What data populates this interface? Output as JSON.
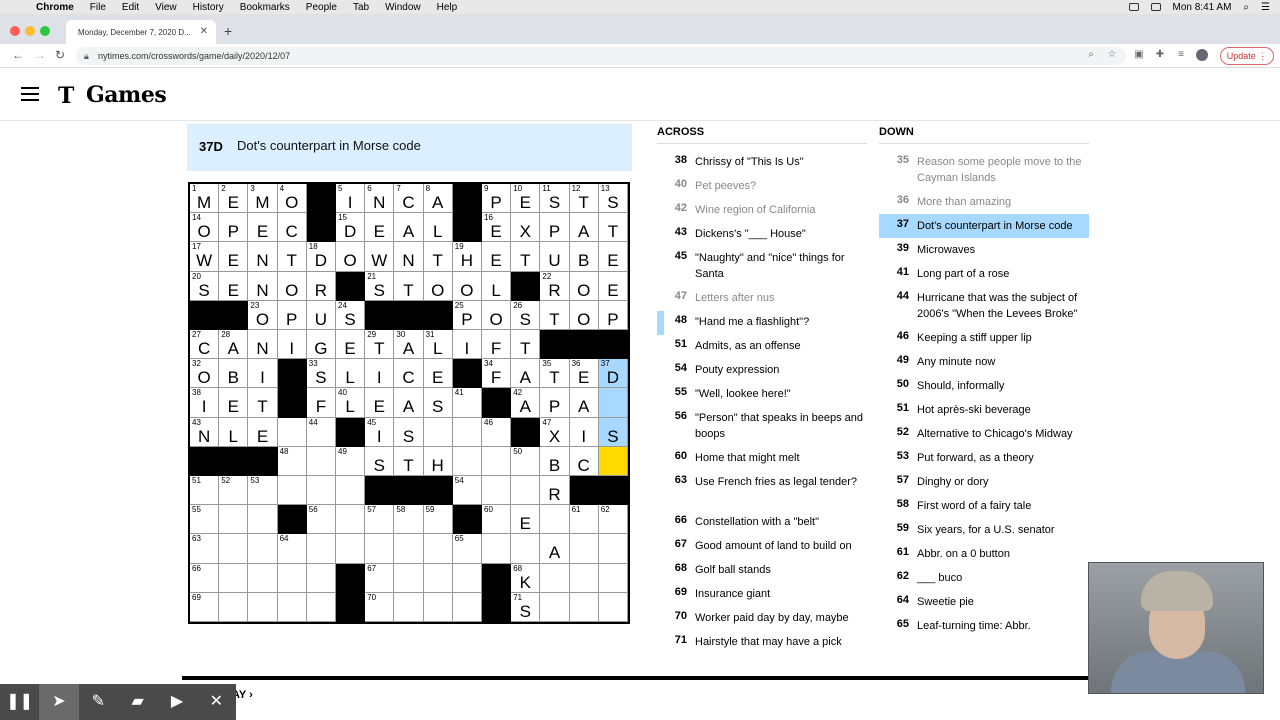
{
  "menubar": {
    "items": [
      "Chrome",
      "File",
      "Edit",
      "View",
      "History",
      "Bookmarks",
      "People",
      "Tab",
      "Window",
      "Help"
    ],
    "clock": "Mon 8:41 AM"
  },
  "browser": {
    "tab_title": "Monday, December 7, 2020 D...",
    "url": "nytimes.com/crosswords/game/daily/2020/12/07",
    "update_label": "Update"
  },
  "site": {
    "logo_mark": "T",
    "logo_text": "Games"
  },
  "active_clue": {
    "label": "37D",
    "text": "Dot's counterpart in Morse code"
  },
  "grid": {
    "size": 15,
    "rows": [
      "MEMO#INCA#PESTS",
      "OPEC#DEAL#EXPAT",
      "WENTDOWNTHETUBE",
      "SENOR#STOOL#ROE",
      "##OPUS###POSTOP",
      "CANIGETALIFT###",
      "OBI#SLICE#FATED",
      "IET#FLEAS#NAPA",
      "NLE  LIS    XIS",
      "###   STH   BC ",
      "      ###   R##",
      "   #      #E   ",
      "            A  ",
      "     #    #K   ",
      "     #    #S   "
    ],
    "black_cells": [
      [
        0,
        4
      ],
      [
        0,
        9
      ],
      [
        1,
        4
      ],
      [
        1,
        9
      ],
      [
        3,
        5
      ],
      [
        3,
        11
      ],
      [
        4,
        0
      ],
      [
        4,
        1
      ],
      [
        4,
        6
      ],
      [
        4,
        7
      ],
      [
        4,
        8
      ],
      [
        5,
        12
      ],
      [
        5,
        13
      ],
      [
        5,
        14
      ],
      [
        6,
        3
      ],
      [
        6,
        9
      ],
      [
        7,
        3
      ],
      [
        7,
        10
      ],
      [
        8,
        5
      ],
      [
        8,
        11
      ],
      [
        9,
        0
      ],
      [
        9,
        1
      ],
      [
        9,
        2
      ],
      [
        10,
        6
      ],
      [
        10,
        7
      ],
      [
        10,
        8
      ],
      [
        10,
        13
      ],
      [
        10,
        14
      ],
      [
        11,
        3
      ],
      [
        11,
        9
      ],
      [
        13,
        5
      ],
      [
        13,
        10
      ],
      [
        14,
        5
      ],
      [
        14,
        10
      ]
    ],
    "numbers": {
      "0,0": "1",
      "0,1": "2",
      "0,2": "3",
      "0,3": "4",
      "0,5": "5",
      "0,6": "6",
      "0,7": "7",
      "0,8": "8",
      "0,10": "9",
      "0,11": "10",
      "0,12": "11",
      "0,13": "12",
      "0,14": "13",
      "1,0": "14",
      "1,5": "15",
      "1,10": "16",
      "2,0": "17",
      "2,4": "18",
      "2,9": "19",
      "3,0": "20",
      "3,6": "21",
      "3,12": "22",
      "4,2": "23",
      "4,5": "24",
      "4,9": "25",
      "4,11": "26",
      "5,0": "27",
      "5,1": "28",
      "5,6": "29",
      "5,7": "30",
      "5,8": "31",
      "6,0": "32",
      "6,4": "33",
      "6,10": "34",
      "6,12": "35",
      "6,13": "36",
      "6,14": "37",
      "7,0": "38",
      "7,3": "39",
      "7,5": "40",
      "7,9": "41",
      "7,11": "42",
      "8,0": "43",
      "8,4": "44",
      "8,6": "45",
      "8,10": "46",
      "8,12": "47",
      "9,3": "48",
      "9,5": "49",
      "9,11": "50",
      "10,0": "51",
      "10,1": "52",
      "10,2": "53",
      "10,9": "54",
      "11,0": "55",
      "11,4": "56",
      "11,6": "57",
      "11,7": "58",
      "11,8": "59",
      "11,10": "60",
      "11,13": "61",
      "11,14": "62",
      "12,0": "63",
      "12,3": "64",
      "12,9": "65",
      "13,0": "66",
      "13,6": "67",
      "13,11": "68",
      "14,0": "69",
      "14,6": "70",
      "14,11": "71"
    },
    "highlighted": [
      [
        6,
        14
      ],
      [
        7,
        14
      ],
      [
        8,
        14
      ]
    ],
    "selected": [
      9,
      14
    ]
  },
  "across": {
    "title": "ACROSS",
    "clues": [
      {
        "n": "38",
        "t": "Chrissy of \"This Is Us\"",
        "state": "normal"
      },
      {
        "n": "40",
        "t": "Pet peeves?",
        "state": "dim"
      },
      {
        "n": "42",
        "t": "Wine region of California",
        "state": "dim"
      },
      {
        "n": "43",
        "t": "Dickens's \"___ House\"",
        "state": "normal"
      },
      {
        "n": "45",
        "t": "\"Naughty\" and \"nice\" things for Santa",
        "state": "normal"
      },
      {
        "n": "47",
        "t": "Letters after nus",
        "state": "dim"
      },
      {
        "n": "48",
        "t": "\"Hand me a flashlight\"?",
        "state": "normal"
      },
      {
        "n": "51",
        "t": "Admits, as an offense",
        "state": "normal"
      },
      {
        "n": "54",
        "t": "Pouty expression",
        "state": "normal"
      },
      {
        "n": "55",
        "t": "\"Well, lookee here!\"",
        "state": "normal"
      },
      {
        "n": "56",
        "t": "\"Person\" that speaks in beeps and boops",
        "state": "normal"
      },
      {
        "n": "60",
        "t": "Home that might melt",
        "state": "normal"
      },
      {
        "n": "63",
        "t": "Use French fries as legal tender?",
        "state": "normal"
      },
      {
        "n": "66",
        "t": "Constellation with a \"belt\"",
        "state": "normal"
      },
      {
        "n": "67",
        "t": "Good amount of land to build on",
        "state": "normal"
      },
      {
        "n": "68",
        "t": "Golf ball stands",
        "state": "normal"
      },
      {
        "n": "69",
        "t": "Insurance giant",
        "state": "normal"
      },
      {
        "n": "70",
        "t": "Worker paid day by day, maybe",
        "state": "normal"
      },
      {
        "n": "71",
        "t": "Hairstyle that may have a pick",
        "state": "normal"
      }
    ]
  },
  "down": {
    "title": "DOWN",
    "clues": [
      {
        "n": "35",
        "t": "Reason some people move to the Cayman Islands",
        "state": "dim"
      },
      {
        "n": "36",
        "t": "More than amazing",
        "state": "dim"
      },
      {
        "n": "37",
        "t": "Dot's counterpart in Morse code",
        "state": "active"
      },
      {
        "n": "39",
        "t": "Microwaves",
        "state": "normal"
      },
      {
        "n": "41",
        "t": "Long part of a rose",
        "state": "normal"
      },
      {
        "n": "44",
        "t": "Hurricane that was the subject of 2006's \"When the Levees Broke\"",
        "state": "normal"
      },
      {
        "n": "46",
        "t": "Keeping a stiff upper lip",
        "state": "normal"
      },
      {
        "n": "49",
        "t": "Any minute now",
        "state": "normal"
      },
      {
        "n": "50",
        "t": "Should, informally",
        "state": "normal"
      },
      {
        "n": "51",
        "t": "Hot après-ski beverage",
        "state": "normal"
      },
      {
        "n": "52",
        "t": "Alternative to Chicago's Midway",
        "state": "normal"
      },
      {
        "n": "53",
        "t": "Put forward, as a theory",
        "state": "normal"
      },
      {
        "n": "57",
        "t": "Dinghy or dory",
        "state": "normal"
      },
      {
        "n": "58",
        "t": "First word of a fairy tale",
        "state": "normal"
      },
      {
        "n": "59",
        "t": "Six years, for a U.S. senator",
        "state": "normal"
      },
      {
        "n": "61",
        "t": "Abbr. on a 0 button",
        "state": "normal"
      },
      {
        "n": "62",
        "t": "___ buco",
        "state": "normal"
      },
      {
        "n": "64",
        "t": "Sweetie pie",
        "state": "normal"
      },
      {
        "n": "65",
        "t": "Leaf-turning time: Abbr.",
        "state": "normal"
      }
    ]
  },
  "bottom": {
    "text": "AY ›"
  },
  "colors": {
    "highlight": "#a7d8ff",
    "selected": "#ffda00",
    "cluebar": "#dcefff"
  }
}
